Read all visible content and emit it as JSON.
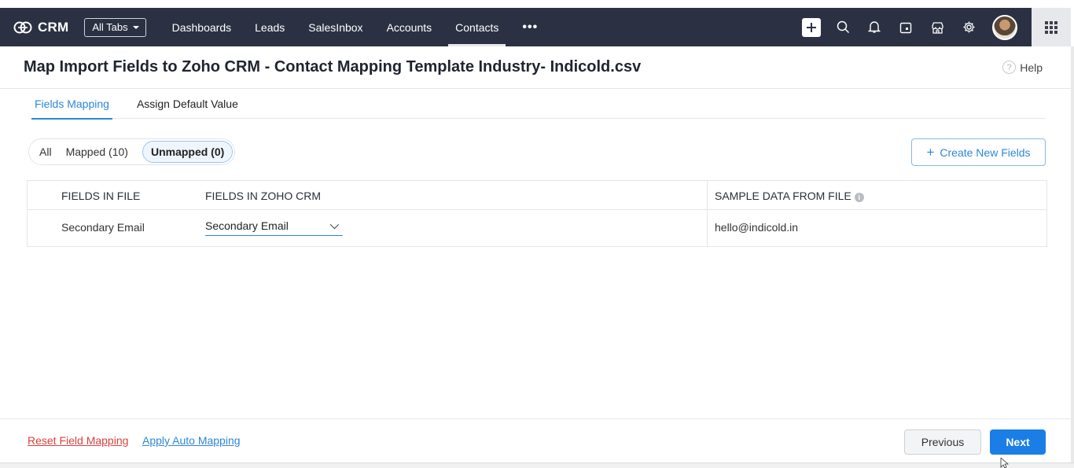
{
  "nav": {
    "brand": "CRM",
    "all_tabs": "All Tabs",
    "tabs": [
      {
        "label": "Dashboards"
      },
      {
        "label": "Leads"
      },
      {
        "label": "SalesInbox"
      },
      {
        "label": "Accounts"
      },
      {
        "label": "Contacts",
        "active": true
      }
    ],
    "more": "•••",
    "icons": [
      "plus-icon",
      "search-icon",
      "bell-icon",
      "calendar-icon",
      "store-icon",
      "gear-icon",
      "avatar",
      "app-grid-icon"
    ]
  },
  "header": {
    "title": "Map Import Fields to Zoho CRM - Contact Mapping Template Industry- Indicold.csv",
    "help": "Help"
  },
  "subtabs": {
    "fields_mapping": "Fields Mapping",
    "assign_default": "Assign Default Value"
  },
  "filters": {
    "all": "All",
    "mapped": "Mapped (10)",
    "unmapped": "Unmapped (0)",
    "active": "unmapped"
  },
  "create_button": "Create New Fields",
  "table": {
    "headers": {
      "fields_in_file": "FIELDS IN FILE",
      "fields_in_crm": "FIELDS IN ZOHO CRM",
      "sample_data": "SAMPLE DATA FROM FILE"
    },
    "rows": [
      {
        "file_field": "Secondary Email",
        "crm_field": "Secondary Email",
        "sample": "hello@indicold.in"
      }
    ]
  },
  "footer": {
    "reset": "Reset Field Mapping",
    "auto": "Apply Auto Mapping",
    "previous": "Previous",
    "next": "Next"
  },
  "colors": {
    "navbar": "#2b3142",
    "accent": "#2e87d8",
    "primary_button": "#1a7ee6",
    "danger_link": "#d6423f"
  }
}
